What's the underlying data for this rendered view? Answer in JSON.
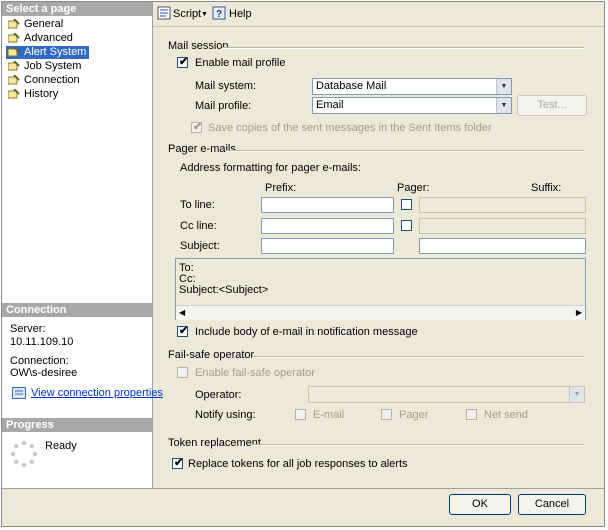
{
  "left": {
    "select_header": "Select a page",
    "nav": [
      "General",
      "Advanced",
      "Alert System",
      "Job System",
      "Connection",
      "History"
    ],
    "connection_header": "Connection",
    "server_label": "Server:",
    "server_value": "10.11.109.10",
    "connection_label": "Connection:",
    "connection_value": "OW\\s-desiree",
    "view_props_link": "View connection properties",
    "progress_header": "Progress",
    "progress_status": "Ready"
  },
  "toolbar": {
    "script_label": "Script",
    "help_label": "Help"
  },
  "mail_session": {
    "title": "Mail session",
    "enable_profile": "Enable mail profile",
    "mail_system_label": "Mail system:",
    "mail_system_value": "Database Mail",
    "mail_profile_label": "Mail profile:",
    "mail_profile_value": "Email",
    "test_button": "Test...",
    "save_copies": "Save copies of the sent messages in the Sent Items folder"
  },
  "pager": {
    "title": "Pager e-mails",
    "address_formatting": "Address formatting for pager e-mails:",
    "prefix_header": "Prefix:",
    "pager_header": "Pager:",
    "suffix_header": "Suffix:",
    "to_line": "To line:",
    "cc_line": "Cc line:",
    "subject": "Subject:",
    "preview_lines": [
      "To:",
      "Cc:",
      "Subject:<Subject>"
    ],
    "include_body": "Include body of e-mail in notification message"
  },
  "failsafe": {
    "title": "Fail-safe operator",
    "enable": "Enable fail-safe operator",
    "operator_label": "Operator:",
    "notify_using": "Notify using:",
    "email": "E-mail",
    "pager": "Pager",
    "net_send": "Net send"
  },
  "token": {
    "title": "Token replacement",
    "replace": "Replace tokens for all job responses to alerts"
  },
  "footer": {
    "ok": "OK",
    "cancel": "Cancel"
  }
}
